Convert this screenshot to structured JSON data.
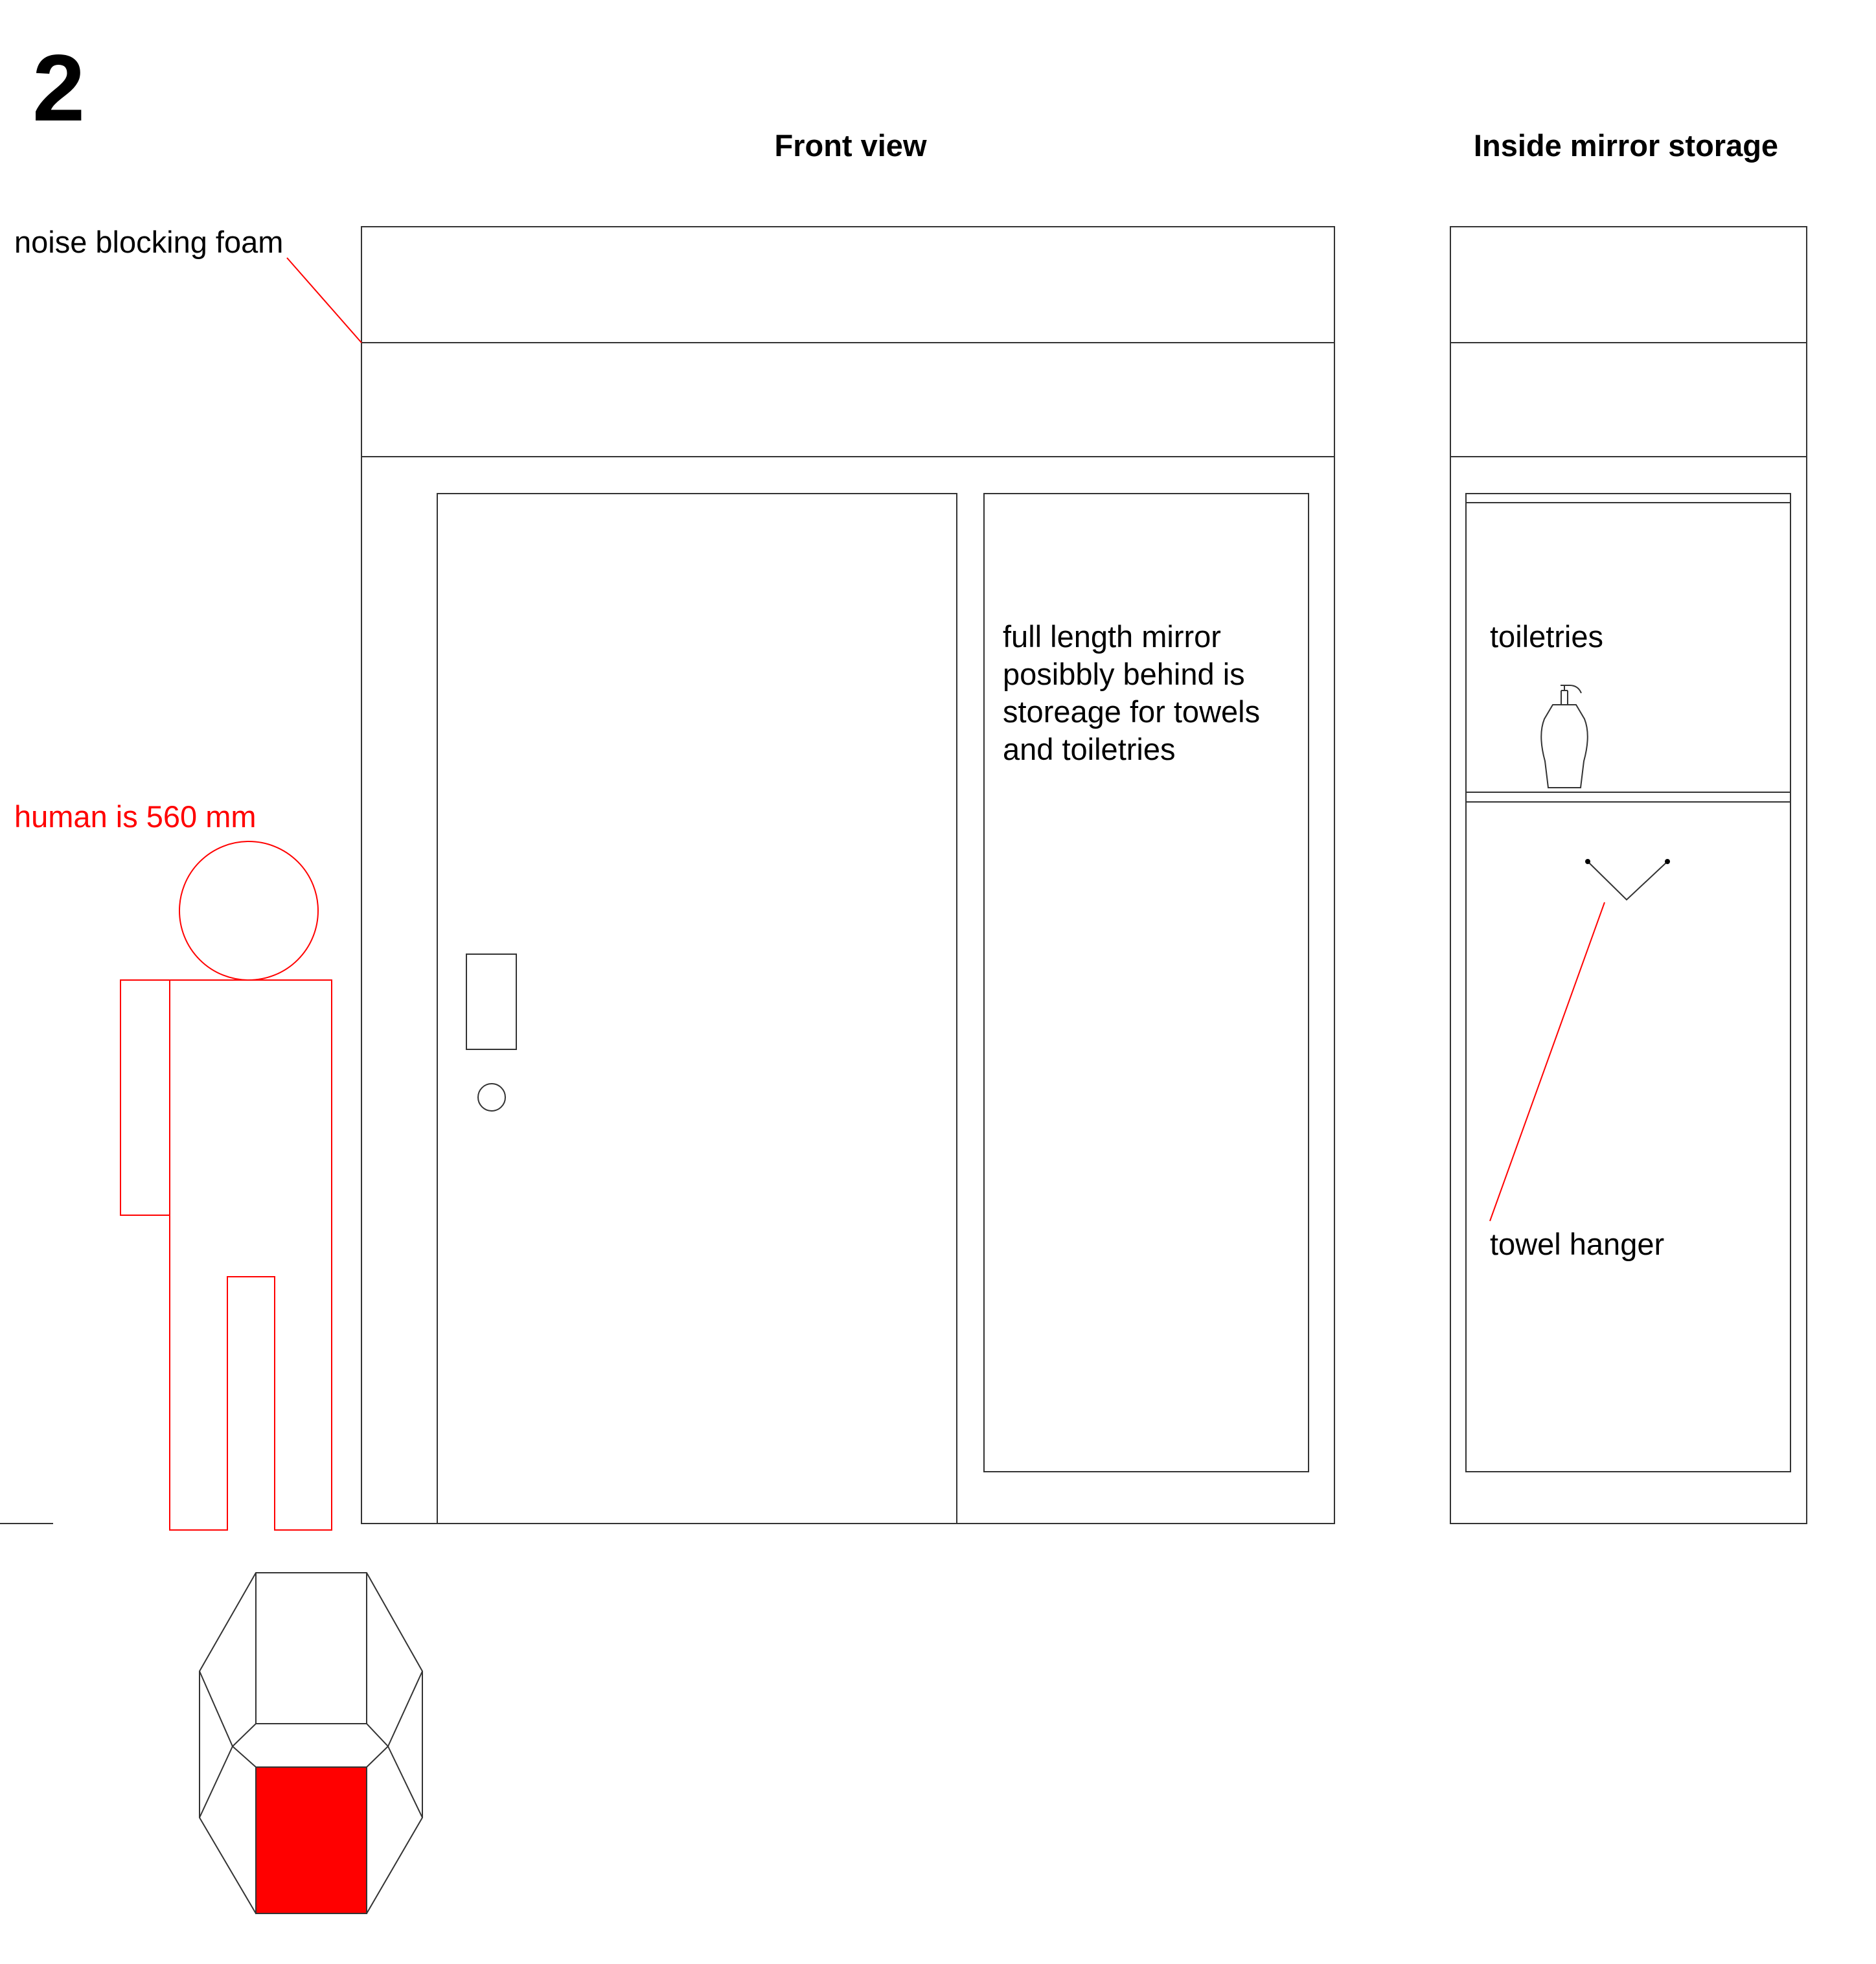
{
  "page_number": "2",
  "headings": {
    "front_view": "Front view",
    "inside_mirror_storage": "Inside mirror storage"
  },
  "labels": {
    "noise_blocking_foam": "noise blocking foam",
    "human_scale": "human is 560 mm",
    "mirror_note": [
      "full length mirror",
      "posibbly behind is",
      "storeage for towels",
      "and toiletries"
    ],
    "toiletries": "toiletries",
    "towel_hanger": "towel hanger"
  },
  "colors": {
    "line": "#333333",
    "accent": "#ff0000",
    "text": "#000000"
  }
}
